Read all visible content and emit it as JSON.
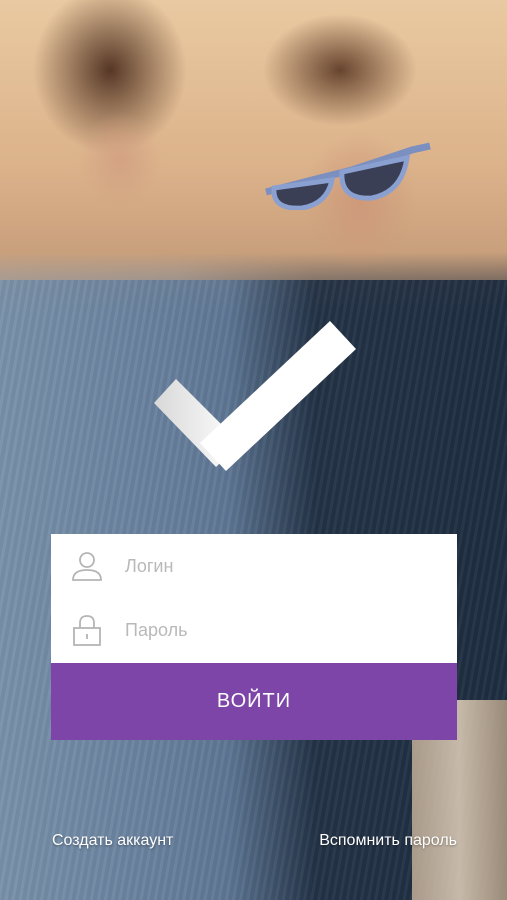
{
  "login_form": {
    "login_placeholder": "Логин",
    "password_placeholder": "Пароль",
    "submit_label": "ВОЙТИ",
    "accent_color": "#7e45a8"
  },
  "icons": {
    "logo": "checkmark-icon",
    "login": "user-icon",
    "password": "lock-icon"
  },
  "footer": {
    "create_account": "Создать аккаунт",
    "forgot_password": "Вспомнить пароль"
  }
}
